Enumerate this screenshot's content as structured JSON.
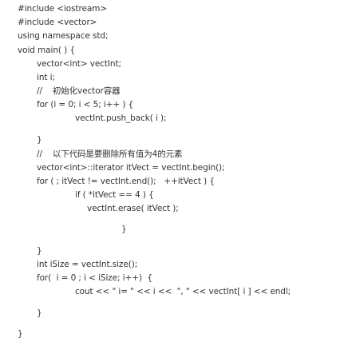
{
  "code": {
    "lines": [
      "#include <iostream>",
      "#include <vector>",
      "using namespace std;",
      "void main( ) {",
      "vector<int> vectInt;",
      "int i;",
      "//    初始化vector容器",
      "for (i = 0; i < 5; i++ ) {",
      "vectInt.push_back( i );",
      "}",
      "//    以下代码是要删除所有值为4的元素",
      "vector<int>::iterator itVect = vectInt.begin();",
      "for ( ; itVect != vectInt.end();   ++itVect ) {",
      "if ( *itVect == 4 ) {",
      "vectInt.erase( itVect );",
      "}",
      "}",
      "int iSize = vectInt.size();",
      "for(  i = 0 ; i < iSize; i++)  {",
      "cout << \" i= \" << i <<  \", \" << vectInt[ i ] << endl;",
      "}",
      "}"
    ]
  }
}
